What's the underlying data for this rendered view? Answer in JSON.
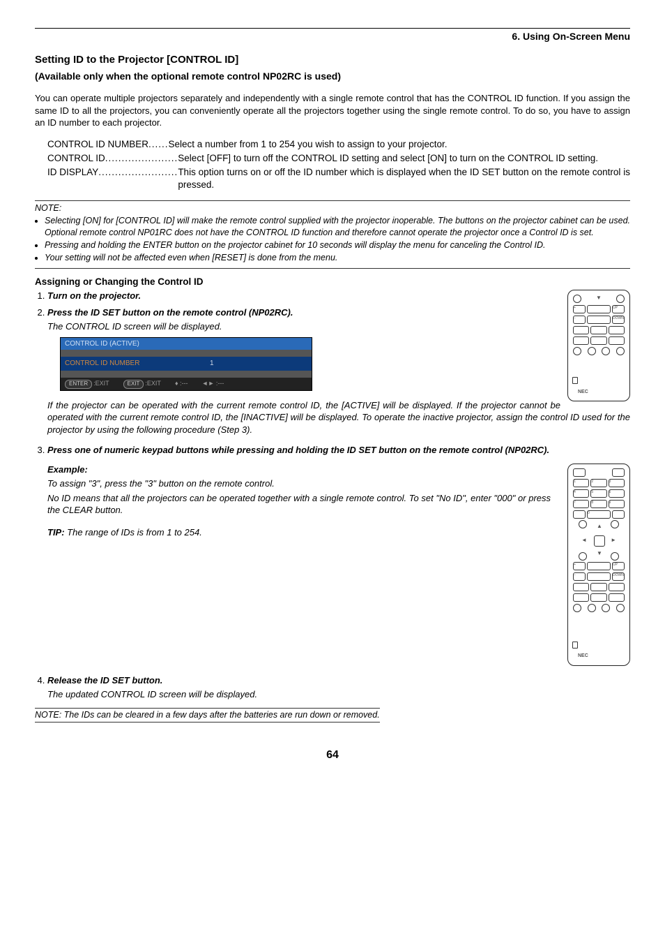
{
  "header": {
    "chapter": "6. Using On-Screen Menu"
  },
  "title": "Setting ID to the Projector [CONTROL ID]",
  "subtitle": "(Available only when the optional remote control NP02RC is used)",
  "intro": "You can operate multiple projectors separately and independently with a single remote control that has the CONTROL ID function. If you assign the same ID to all the projectors, you can conveniently operate all the projectors together using the single remote control. To do so, you have to assign an ID number to each projector.",
  "defs": [
    {
      "label": "CONTROL ID NUMBER",
      "dots": "......",
      "desc": "Select a number from 1 to 254 you wish to assign to your projector."
    },
    {
      "label": "CONTROL ID",
      "dots": "......................",
      "desc": "Select [OFF] to turn off the CONTROL ID setting and select [ON] to turn on the CONTROL ID setting."
    },
    {
      "label": "ID DISPLAY",
      "dots": "........................",
      "desc": "This option turns on or off the ID number which is displayed when the ID SET button on the remote control is pressed."
    }
  ],
  "notes": {
    "heading": "NOTE:",
    "items": [
      "Selecting [ON] for [CONTROL ID] will make the remote control supplied with the projector inoperable. The buttons on the projector cabinet can be used. Optional remote control NP01RC does not have the CONTROL ID function and therefore cannot operate the projector once a Control ID is set.",
      "Pressing and holding the ENTER button on the projector cabinet for 10 seconds will display the menu for canceling the Control ID.",
      "Your setting will not be affected even when [RESET] is done from the menu."
    ]
  },
  "procedure": {
    "heading": "Assigning or Changing the Control ID",
    "steps": [
      {
        "title": "Turn on the projector."
      },
      {
        "title": "Press the ID SET button on the remote control (NP02RC).",
        "body": "The CONTROL ID screen will be displayed.",
        "after": "If the projector can be operated with the current remote control ID, the [ACTIVE] will be displayed. If the projector cannot be operated with the current remote control ID, the [INACTIVE] will be displayed. To operate the inactive projector, assign the control ID used for the projector by using the following procedure (Step 3)."
      },
      {
        "title": "Press one of numeric keypad buttons while pressing and holding the ID SET button on the remote control (NP02RC).",
        "example_label": "Example:",
        "example1": "To assign \"3\", press the \"3\" button on the remote control.",
        "example2": "No ID means that all the projectors can be operated together with a single remote control. To set \"No ID\", enter \"000\" or press the CLEAR button.",
        "tip_label": "TIP:",
        "tip": " The range of IDs is from 1 to 254."
      },
      {
        "title": "Release the ID SET button.",
        "body": "The updated CONTROL ID screen will be displayed."
      }
    ]
  },
  "osd": {
    "title": "CONTROL ID (ACTIVE)",
    "row_label": "CONTROL ID NUMBER",
    "row_value": "1",
    "footer": {
      "enter_btn": "ENTER",
      "enter_text": ":EXIT",
      "exit_btn": "EXIT",
      "exit_text": ":EXIT",
      "arrows1": ":---",
      "arrows2": ":---"
    }
  },
  "noteline": "NOTE: The IDs can be cleared in a few days after the batteries are run down or removed.",
  "page": "64",
  "remote_logo": "NEC"
}
